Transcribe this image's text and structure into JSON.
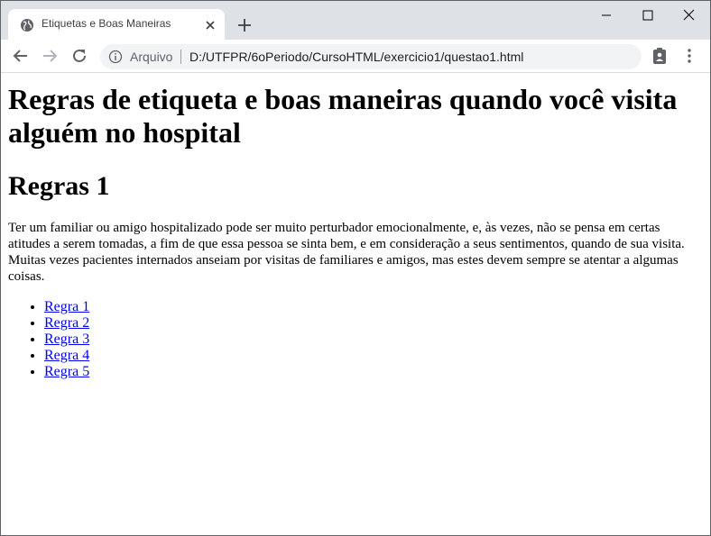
{
  "browser": {
    "tab_title": "Etiquetas e Boas Maneiras",
    "scheme_label": "Arquivo",
    "url": "D:/UTFPR/6oPeriodo/CursoHTML/exercicio1/questao1.html"
  },
  "page": {
    "heading": "Regras de etiqueta e boas maneiras quando você visita alguém no hospital",
    "subheading": "Regras 1",
    "intro": "Ter um familiar ou amigo hospitalizado pode ser muito perturbador emocionalmente, e, às vezes, não se pensa em certas atitudes a serem tomadas, a fim de que essa pessoa se sinta bem, e em consideração a seus sentimentos, quando de sua visita. Muitas vezes pacientes internados anseiam por visitas de familiares e amigos, mas estes devem sempre se atentar a algumas coisas.",
    "rules": [
      {
        "label": "Regra 1"
      },
      {
        "label": "Regra 2"
      },
      {
        "label": "Regra 3"
      },
      {
        "label": "Regra 4"
      },
      {
        "label": "Regra 5"
      }
    ]
  },
  "colors": {
    "link": "#0000ee",
    "tabstrip": "#dee1e6"
  }
}
